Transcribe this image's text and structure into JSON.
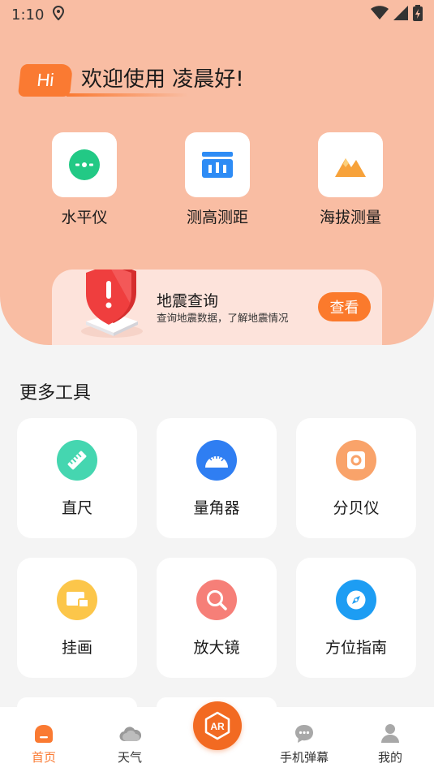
{
  "status_bar": {
    "time": "1:10"
  },
  "greeting": {
    "hi": "Hi",
    "text": "欢迎使用 凌晨好!"
  },
  "quick_tools": [
    {
      "label": "水平仪",
      "icon": "level-icon",
      "color": "#22c985"
    },
    {
      "label": "测高测距",
      "icon": "height-measure-icon",
      "color": "#2e8cf5"
    },
    {
      "label": "海拔测量",
      "icon": "mountain-icon",
      "color": "#f7a23a"
    }
  ],
  "quake": {
    "title": "地震查询",
    "desc": "查询地震数据，了解地震情况",
    "button": "查看",
    "shield_color": "#ef3e3e"
  },
  "more_tools": {
    "title": "更多工具",
    "items": [
      {
        "label": "直尺",
        "icon": "ruler-icon",
        "color": "#45d6b0"
      },
      {
        "label": "量角器",
        "icon": "protractor-icon",
        "color": "#2f7ef2"
      },
      {
        "label": "分贝仪",
        "icon": "decibel-icon",
        "color": "#f9a36a"
      },
      {
        "label": "挂画",
        "icon": "picture-icon",
        "color": "#fcc64a"
      },
      {
        "label": "放大镜",
        "icon": "magnifier-icon",
        "color": "#f67f78"
      },
      {
        "label": "方位指南",
        "icon": "compass-icon",
        "color": "#1d9df3"
      }
    ]
  },
  "nav": {
    "items": [
      {
        "label": "首页",
        "icon": "home-icon",
        "active": true
      },
      {
        "label": "天气",
        "icon": "cloud-icon",
        "active": false
      },
      {
        "label": "手机弹幕",
        "icon": "chat-icon",
        "active": false
      },
      {
        "label": "我的",
        "icon": "user-icon",
        "active": false
      }
    ],
    "ar_label": "AR",
    "accent": "#fa7a32"
  }
}
